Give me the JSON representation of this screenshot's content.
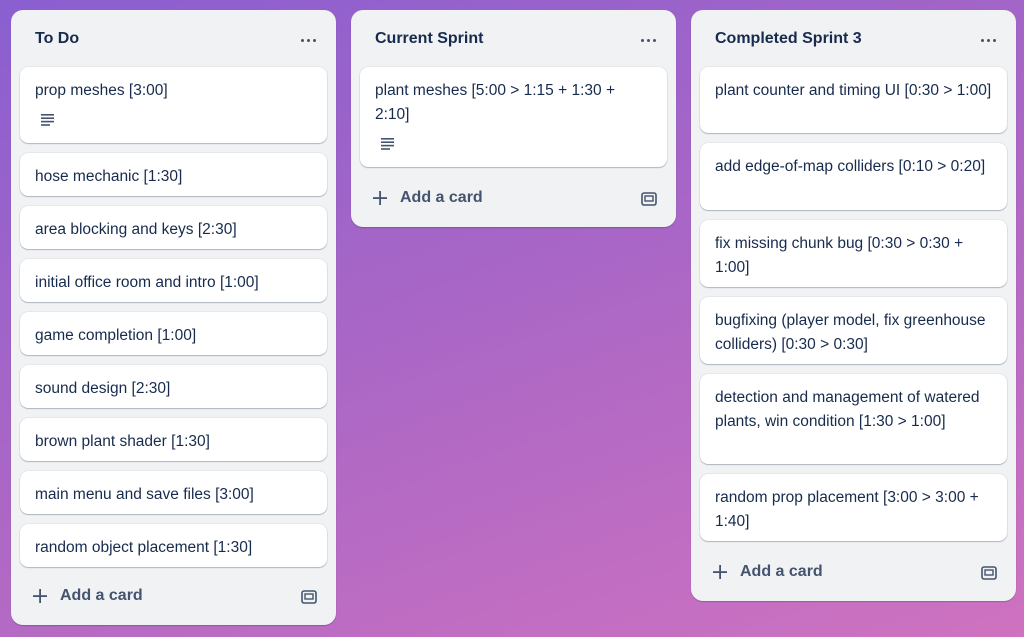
{
  "lists": [
    {
      "title": "To Do",
      "cards": [
        "prop meshes [3:00]",
        "hose mechanic [1:30]",
        "area blocking and keys [2:30]",
        "initial office room and intro [1:00]",
        "game completion [1:00]",
        "sound design [2:30]",
        "brown plant shader [1:30]",
        "main menu and save files [3:00]",
        "random object placement [1:30]"
      ],
      "add_card_label": "Add a card"
    },
    {
      "title": "Current Sprint",
      "cards": [
        "plant meshes [5:00 > 1:15 + 1:30 + 2:10]"
      ],
      "add_card_label": "Add a card"
    },
    {
      "title": "Completed Sprint 3",
      "cards": [
        "plant counter and timing UI [0:30 > 1:00]",
        "add edge-of-map colliders [0:10 > 0:20]",
        "fix missing chunk bug [0:30 > 0:30 + 1:00]",
        "bugfixing (player model, fix greenhouse colliders) [0:30 > 0:30]",
        "detection and management of watered plants, win condition [1:30 > 1:00]",
        "random prop placement [3:00 > 3:00 + 1:40]"
      ],
      "add_card_label": "Add a card"
    }
  ],
  "icons": {
    "list_menu": "more-horizontal-icon",
    "description": "description-icon",
    "add": "plus-icon",
    "template": "card-template-icon"
  }
}
